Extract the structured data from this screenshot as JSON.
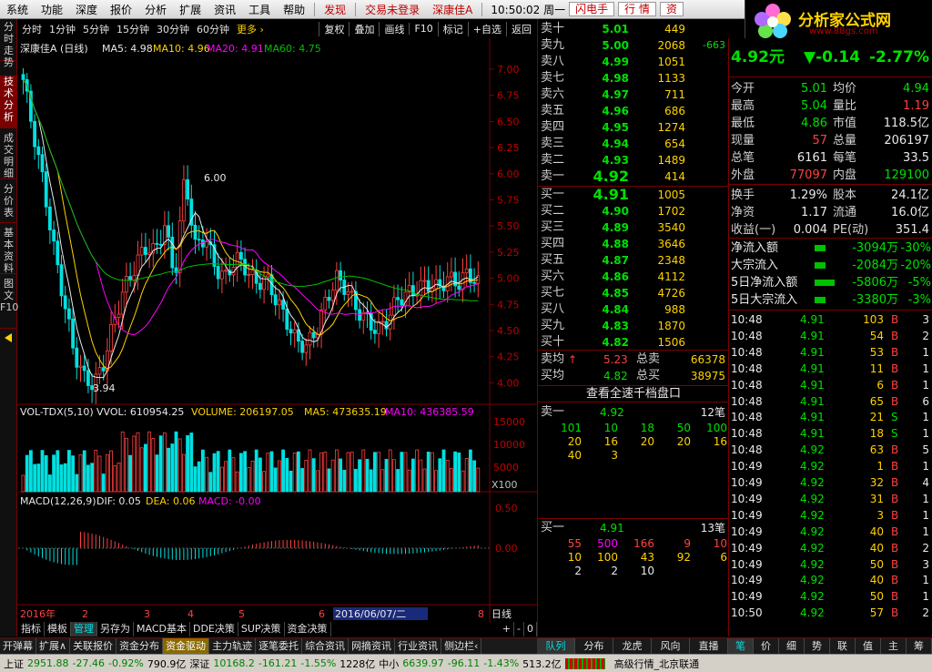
{
  "menu": {
    "items": [
      "系统",
      "功能",
      "深度",
      "报价",
      "分析",
      "扩展",
      "资讯",
      "工具",
      "帮助"
    ],
    "warn": "发现",
    "login": "交易未登录",
    "stock": "深康佳A",
    "time": "10:50:02 周一",
    "btn1": "闪电手",
    "btn2": "行 情",
    "btn3": "资"
  },
  "logo": {
    "title": "分析家公式网",
    "url": "www.88gs.com"
  },
  "lefttabs": [
    "分时走势",
    "技术分析",
    "成交明细",
    "分价表",
    "基本资料",
    "图文F10"
  ],
  "toolbar": {
    "periods": [
      "分时",
      "1分钟",
      "5分钟",
      "15分钟",
      "30分钟",
      "60分钟"
    ],
    "more": "更多 ›",
    "buttons": [
      "复权",
      "叠加",
      "画线",
      "F10",
      "标记",
      "+自选",
      "返回"
    ]
  },
  "kline": {
    "title": "深康佳A (日线)",
    "ma5": "MA5: 4.98",
    "ma10": "MA10: 4.96",
    "ma20": "MA20: 4.91",
    "ma60": "MA60: 4.75",
    "high_label": "6.00",
    "low_label": "3.94",
    "yticks": [
      "7.00",
      "6.75",
      "6.50",
      "6.25",
      "6.00",
      "5.75",
      "5.50",
      "5.25",
      "5.00",
      "4.75",
      "4.50",
      "4.25",
      "4.00"
    ]
  },
  "vol": {
    "title": "VOL-TDX(5,10)",
    "vvol": "VVOL: 610954.25",
    "volume": "VOLUME: 206197.05",
    "ma5": "MA5: 473635.19",
    "ma10": "MA10: 436385.59",
    "yticks": [
      "15000",
      "10000",
      "5000"
    ],
    "unit": "X100"
  },
  "macd": {
    "title": "MACD(12,26,9)",
    "dif": "DIF: 0.05",
    "dea": "DEA: 0.06",
    "macd": "MACD: -0.00",
    "yticks": [
      "0.50",
      "0.00"
    ]
  },
  "xaxis": {
    "labels": [
      "2016年",
      "2",
      "3",
      "4",
      "5",
      "6",
      "8"
    ],
    "cursor_date": "2016/06/07/二",
    "period": "日线"
  },
  "bottomtabs": [
    "指标",
    "模板",
    "管理",
    "另存为",
    "MACD基本",
    "DDE决策",
    "SUP决策",
    "资金决策"
  ],
  "bottomctrl": [
    "+",
    "-",
    "0"
  ],
  "asks": [
    {
      "label": "卖十",
      "price": "5.01",
      "vol": "449",
      "chg": ""
    },
    {
      "label": "卖九",
      "price": "5.00",
      "vol": "2068",
      "chg": "-663"
    },
    {
      "label": "卖八",
      "price": "4.99",
      "vol": "1051",
      "chg": ""
    },
    {
      "label": "卖七",
      "price": "4.98",
      "vol": "1133",
      "chg": ""
    },
    {
      "label": "卖六",
      "price": "4.97",
      "vol": "711",
      "chg": ""
    },
    {
      "label": "卖五",
      "price": "4.96",
      "vol": "686",
      "chg": ""
    },
    {
      "label": "卖四",
      "price": "4.95",
      "vol": "1274",
      "chg": ""
    },
    {
      "label": "卖三",
      "price": "4.94",
      "vol": "654",
      "chg": ""
    },
    {
      "label": "卖二",
      "price": "4.93",
      "vol": "1489",
      "chg": ""
    },
    {
      "label": "卖一",
      "price": "4.92",
      "vol": "414",
      "chg": ""
    }
  ],
  "bids": [
    {
      "label": "买一",
      "price": "4.91",
      "vol": "1005"
    },
    {
      "label": "买二",
      "price": "4.90",
      "vol": "1702"
    },
    {
      "label": "买三",
      "price": "4.89",
      "vol": "3540"
    },
    {
      "label": "买四",
      "price": "4.88",
      "vol": "3646"
    },
    {
      "label": "买五",
      "price": "4.87",
      "vol": "2348"
    },
    {
      "label": "买六",
      "price": "4.86",
      "vol": "4112"
    },
    {
      "label": "买七",
      "price": "4.85",
      "vol": "4726"
    },
    {
      "label": "买八",
      "price": "4.84",
      "vol": "988"
    },
    {
      "label": "买九",
      "price": "4.83",
      "vol": "1870"
    },
    {
      "label": "买十",
      "price": "4.82",
      "vol": "1506"
    }
  ],
  "avg": {
    "ask_label": "卖均",
    "ask": "5.23",
    "tot_ask_label": "总卖",
    "tot_ask": "66378",
    "bid_label": "买均",
    "bid": "4.82",
    "tot_bid_label": "总买",
    "tot_bid": "38975"
  },
  "fast_btn": "查看全速千档盘口",
  "queue1": {
    "label": "卖一",
    "price": "4.92",
    "count": "12笔",
    "rows": [
      [
        "101",
        "10",
        "18",
        "50",
        "100"
      ],
      [
        "20",
        "16",
        "20",
        "20",
        "16"
      ],
      [
        "40",
        "3"
      ]
    ]
  },
  "queue2": {
    "label": "买一",
    "price": "4.91",
    "count": "13笔",
    "rows": [
      [
        "55",
        "500",
        "166",
        "9",
        "10"
      ],
      [
        "10",
        "100",
        "43",
        "92",
        "6"
      ],
      [
        "2",
        "2",
        "10"
      ]
    ]
  },
  "qtabs": [
    "队列",
    "分布",
    "龙虎",
    "风向",
    "直播"
  ],
  "right": {
    "price": "4.92元",
    "change": "▼-0.14",
    "pct": "-2.77%",
    "rows": [
      [
        "今开",
        "5.01",
        "均价",
        "4.94"
      ],
      [
        "最高",
        "5.04",
        "量比",
        "1.19"
      ],
      [
        "最低",
        "4.86",
        "市值",
        "118.5亿"
      ],
      [
        "现量",
        "57",
        "总量",
        "206197"
      ],
      [
        "总笔",
        "6161",
        "每笔",
        "33.5"
      ],
      [
        "外盘",
        "77097",
        "内盘",
        "129100"
      ]
    ],
    "rows2": [
      [
        "换手",
        "1.29%",
        "股本",
        "24.1亿"
      ],
      [
        "净资",
        "1.17",
        "流通",
        "16.0亿"
      ],
      [
        "收益(一)",
        "0.004",
        "PE(动)",
        "351.4"
      ]
    ],
    "flows": [
      [
        "净流入额",
        "-3094万",
        "-30%"
      ],
      [
        "大宗流入",
        "-2084万",
        "-20%"
      ],
      [
        "5日净流入额",
        "-5806万",
        "-5%"
      ],
      [
        "5日大宗流入",
        "-3380万",
        "-3%"
      ]
    ],
    "ticks": [
      [
        "10:48",
        "4.91",
        "103",
        "B",
        "3"
      ],
      [
        "10:48",
        "4.91",
        "54",
        "B",
        "2"
      ],
      [
        "10:48",
        "4.91",
        "53",
        "B",
        "1"
      ],
      [
        "10:48",
        "4.91",
        "11",
        "B",
        "1"
      ],
      [
        "10:48",
        "4.91",
        "6",
        "B",
        "1"
      ],
      [
        "10:48",
        "4.91",
        "65",
        "B",
        "6"
      ],
      [
        "10:48",
        "4.91",
        "21",
        "S",
        "1"
      ],
      [
        "10:48",
        "4.91",
        "18",
        "S",
        "1"
      ],
      [
        "10:48",
        "4.92",
        "63",
        "B",
        "5"
      ],
      [
        "10:49",
        "4.92",
        "1",
        "B",
        "1"
      ],
      [
        "10:49",
        "4.92",
        "32",
        "B",
        "4"
      ],
      [
        "10:49",
        "4.92",
        "31",
        "B",
        "1"
      ],
      [
        "10:49",
        "4.92",
        "3",
        "B",
        "1"
      ],
      [
        "10:49",
        "4.92",
        "40",
        "B",
        "1"
      ],
      [
        "10:49",
        "4.92",
        "40",
        "B",
        "2"
      ],
      [
        "10:49",
        "4.92",
        "50",
        "B",
        "3"
      ],
      [
        "10:49",
        "4.92",
        "40",
        "B",
        "1"
      ],
      [
        "10:49",
        "4.92",
        "50",
        "B",
        "1"
      ],
      [
        "10:50",
        "4.92",
        "57",
        "B",
        "2"
      ]
    ]
  },
  "rtabs": [
    "笔",
    "价",
    "细",
    "势",
    "联",
    "值",
    "主",
    "筹"
  ],
  "ltabs2": [
    "开弹幕",
    "扩展∧",
    "关联报价",
    "资金分布",
    "资金驱动",
    "主力轨迹",
    "逐笔委托",
    "综合资讯",
    "网摘资讯",
    "行业资讯",
    "侧边栏‹"
  ],
  "status": {
    "sh_label": "上证",
    "sh": "2951.88",
    "sh_chg": "-27.46",
    "sh_pct": "-0.92%",
    "sh_amt": "790.9亿",
    "sz_label": "深证",
    "sz": "10168.2",
    "sz_chg": "-161.21",
    "sz_pct": "-1.55%",
    "sz_amt": "1228亿",
    "zx_label": "中小",
    "zx": "6639.97",
    "zx_chg": "-96.11",
    "zx_pct": "-1.43%",
    "zx_amt": "513.2亿",
    "feed": "高级行情_北京联通"
  },
  "colors": {
    "up": "#ff4040",
    "down": "#00e0e0",
    "ma5": "#e8e8e8",
    "ma10": "#ffd200",
    "ma20": "#ff00ff",
    "ma60": "#00c000",
    "frame": "#7a0000"
  }
}
